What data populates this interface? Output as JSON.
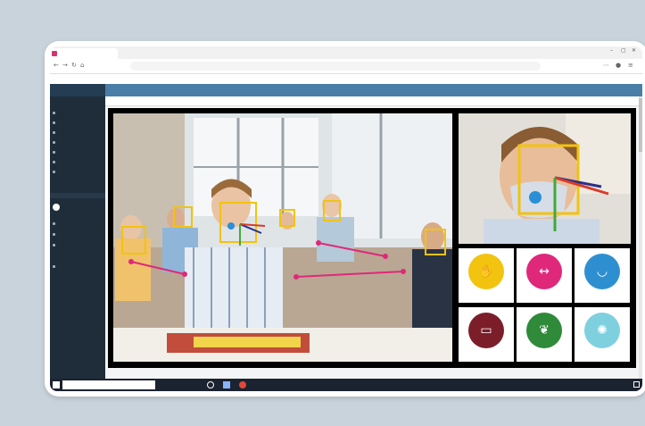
{
  "browser": {
    "tab_title": "",
    "url": "",
    "window_controls": [
      "–",
      "▢",
      "✕"
    ]
  },
  "app": {
    "brand": "",
    "header_title": ""
  },
  "sidebar": {
    "items": [
      {
        "label": ""
      },
      {
        "label": ""
      },
      {
        "label": ""
      },
      {
        "label": ""
      },
      {
        "label": ""
      },
      {
        "label": ""
      },
      {
        "label": ""
      },
      {
        "label": ""
      }
    ],
    "user_initials": "",
    "lower_items": [
      {
        "label": ""
      },
      {
        "label": ""
      },
      {
        "label": ""
      },
      {
        "label": ""
      },
      {
        "label": ""
      },
      {
        "label": ""
      }
    ]
  },
  "page": {
    "title": "",
    "breadcrumb": ""
  },
  "detection": {
    "face_box_color": "#f2c30f",
    "mask_icon_color": "#2b8fd6",
    "distance_line_color": "#e0287a"
  },
  "icons": [
    {
      "name": "hand-sanitizer-icon",
      "color": "#f2c30f",
      "label": "",
      "glyph": "✋"
    },
    {
      "name": "social-distance-icon",
      "color": "#e0287a",
      "label": "",
      "glyph": "↔"
    },
    {
      "name": "face-mask-icon",
      "color": "#2d8fd0",
      "label": "",
      "glyph": "◡"
    },
    {
      "name": "temperature-icon",
      "color": "#7b1e2a",
      "label": "",
      "glyph": "▭"
    },
    {
      "name": "lungs-icon",
      "color": "#2f8a3a",
      "label": "",
      "glyph": "❦"
    },
    {
      "name": "virus-icon",
      "color": "#7ed0df",
      "label": "",
      "glyph": "✺"
    }
  ],
  "taskbar": {
    "search_text": "",
    "time": "",
    "date": ""
  }
}
